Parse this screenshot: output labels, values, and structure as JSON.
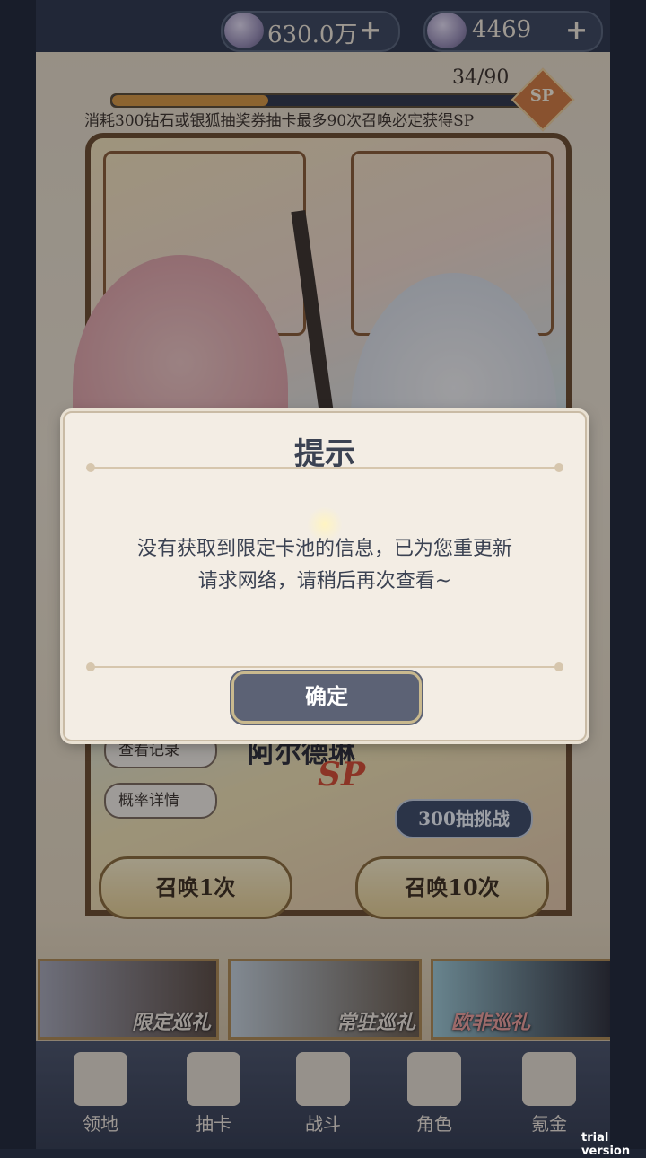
{
  "currencies": [
    {
      "icon": "crystal-icon",
      "value": "630.0万",
      "plus": "+"
    },
    {
      "icon": "fox-ticket-icon",
      "value": "4469",
      "plus": "+"
    }
  ],
  "pity": {
    "count": "34/90",
    "progress": 0.378,
    "badge": "SP",
    "description": "消耗300钻石或银狐抽奖券抽卡最多90次召唤必定获得SP"
  },
  "banner_character": {
    "name": "阿尔德琳",
    "rarity": "SP"
  },
  "side_buttons": [
    "查看记录",
    "概率详情"
  ],
  "challenge_label": "300抽挑战",
  "summon_buttons": [
    {
      "label": "召唤1次",
      "count": "1"
    },
    {
      "label": "召唤10次",
      "count": "10"
    }
  ],
  "banners": [
    "限定巡礼",
    "常驻巡礼",
    "欧非巡礼"
  ],
  "nav": [
    {
      "label": "领地",
      "icon": "castle-icon"
    },
    {
      "label": "抽卡",
      "icon": "card-icon"
    },
    {
      "label": "战斗",
      "icon": "swords-icon"
    },
    {
      "label": "角色",
      "icon": "character-icon"
    },
    {
      "label": "氪金",
      "icon": "treasure-icon"
    }
  ],
  "dialog": {
    "title": "提示",
    "message_line1": "没有获取到限定卡池的信息，已为您重更新",
    "message_line2": "请求网络，请稍后再次查看~",
    "confirm": "确定"
  },
  "watermark": "trial version",
  "colors": {
    "accent": "#5c6275",
    "dialog_bg": "#f3ede4",
    "gold": "#c9b98e"
  }
}
